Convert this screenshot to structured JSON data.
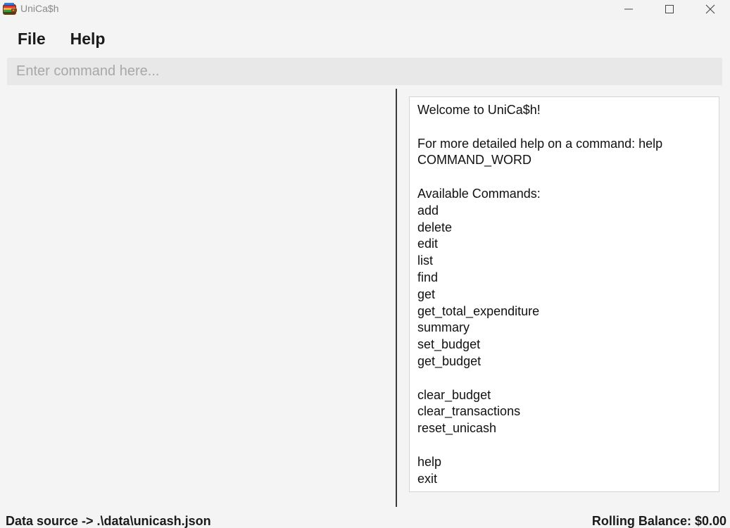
{
  "window": {
    "title": "UniCa$h",
    "icon": "wallet-icon"
  },
  "window_controls": {
    "minimize_icon": "minimize-icon",
    "maximize_icon": "maximize-icon",
    "close_icon": "close-icon"
  },
  "menu": {
    "items": [
      {
        "label": "File"
      },
      {
        "label": "Help"
      }
    ]
  },
  "command": {
    "placeholder": "Enter command here...",
    "value": ""
  },
  "result": {
    "lines": [
      "Welcome to UniCa$h!",
      "",
      "For more detailed help on a command: help",
      "COMMAND_WORD",
      "",
      "Available Commands:",
      "add",
      "delete",
      "edit",
      "list",
      "find",
      "get",
      "get_total_expenditure",
      "summary",
      "set_budget",
      "get_budget",
      "",
      "clear_budget",
      "clear_transactions",
      "reset_unicash",
      "",
      "help",
      "exit"
    ]
  },
  "status": {
    "data_source": "Data source -> .\\data\\unicash.json",
    "rolling_balance": "Rolling Balance: $0.00"
  },
  "colors": {
    "background": "#f4f4f4",
    "command_box": "#e9e8e8",
    "divider": "#3c3c3c",
    "result_bg": "#ffffff"
  }
}
